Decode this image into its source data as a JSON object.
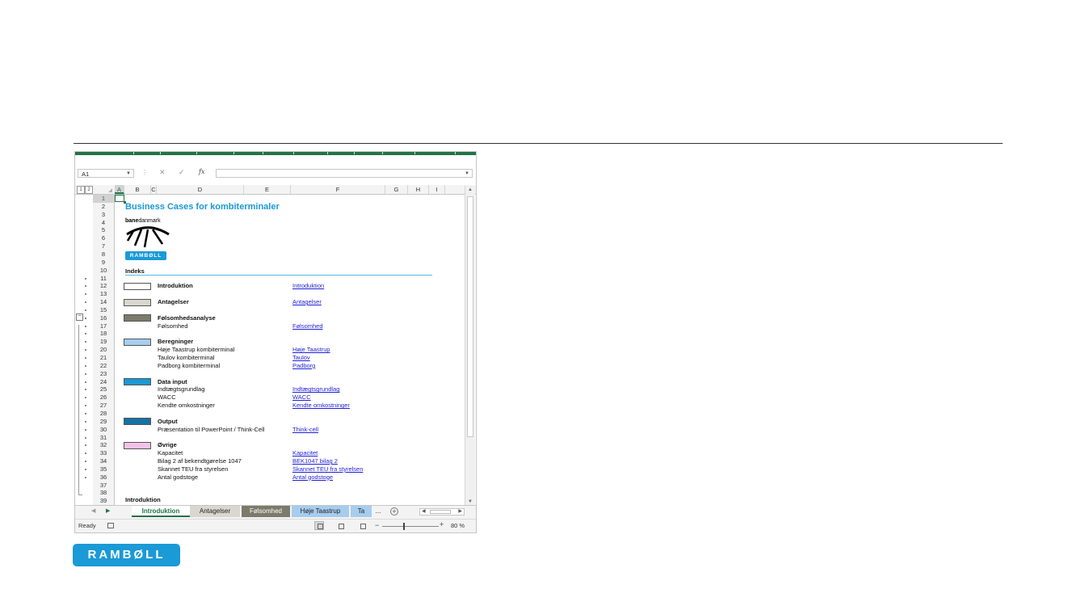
{
  "formula_bar": {
    "name_box": "A1",
    "fx": "fx",
    "formula": ""
  },
  "grid": {
    "level_buttons": [
      "1",
      "2"
    ],
    "columns": [
      "A",
      "B",
      "C",
      "D",
      "E",
      "F",
      "G",
      "H",
      "I"
    ],
    "rows": [
      "1",
      "2",
      "3",
      "4",
      "5",
      "6",
      "7",
      "8",
      "9",
      "10",
      "11",
      "12",
      "13",
      "14",
      "15",
      "16",
      "17",
      "18",
      "19",
      "20",
      "21",
      "22",
      "23",
      "24",
      "25",
      "26",
      "27",
      "28",
      "29",
      "30",
      "31",
      "32",
      "33",
      "34",
      "35",
      "36",
      "37",
      "38",
      "39"
    ],
    "outline_collapse": "−"
  },
  "sheet": {
    "title": "Business Cases for kombiterminaler",
    "banedanmark_bold": "bane",
    "banedanmark_rest": "danmark",
    "ramboll_small": "RAMBØLL",
    "index_heading": "Indeks",
    "sections": [
      {
        "heading": "Introduktion",
        "color": "#ffffff",
        "items": [],
        "link": "Introduktion"
      },
      {
        "heading": "Antagelser",
        "color": "#d8d8d0",
        "items": [],
        "link": "Antagelser"
      },
      {
        "heading": "Følsomhedsanalyse",
        "color": "#7b7b6b",
        "items": [
          {
            "label": "Følsomhed",
            "link": "Følsomhed"
          }
        ]
      },
      {
        "heading": "Beregninger",
        "color": "#a6cdee",
        "items": [
          {
            "label": "Høje Taastrup kombiterminal",
            "link": "Høje Taastrup"
          },
          {
            "label": "Taulov kombiterminal",
            "link": "Taulov"
          },
          {
            "label": "Padborg kombiterminal",
            "link": "Padborg"
          }
        ]
      },
      {
        "heading": "Data input",
        "color": "#1a98d5",
        "items": [
          {
            "label": "Indtægtsgrundlag",
            "link": "Indtægtsgrundlag"
          },
          {
            "label": "WACC",
            "link": "WACC"
          },
          {
            "label": "Kendte omkostninger",
            "link": "Kendte omkostninger"
          }
        ]
      },
      {
        "heading": "Output",
        "color": "#1473a4",
        "items": [
          {
            "label": "Præsentation til PowerPoint / Think-Cell",
            "link": "Think-cell"
          }
        ]
      },
      {
        "heading": "Øvrige",
        "color": "#f4c2e8",
        "items": [
          {
            "label": "Kapacitet",
            "link": "Kapacitet"
          },
          {
            "label": "Bilag 2 af bekendtgørelse 1047",
            "link": "BEK1047 bilag 2"
          },
          {
            "label": "Skannet TEU fra styrelsen",
            "link": "Skannet TEU fra styrelsen"
          },
          {
            "label": "Antal godstoge",
            "link": "Antal godstoge"
          }
        ]
      }
    ],
    "bottom_heading": "Introduktion"
  },
  "tabs": {
    "items": [
      {
        "label": "Introduktion",
        "color": "#ffffff"
      },
      {
        "label": "Antagelser",
        "color": "#d8d8d0"
      },
      {
        "label": "Følsomhed",
        "color": "#7b7b6b"
      },
      {
        "label": "Høje Taastrup",
        "color": "#a6cdee"
      },
      {
        "label": "Ta",
        "color": "#a6cdee"
      }
    ],
    "ellipsis": "...",
    "add": "+"
  },
  "status": {
    "ready": "Ready",
    "zoom_minus": "−",
    "zoom_plus": "+",
    "zoom": "80 %",
    "zoom_level_percent": 80
  },
  "footer": {
    "ramboll_logo": "RAMBØLL"
  },
  "colors": {
    "excel_green": "#217346",
    "ramboll_blue": "#1a9ad6",
    "title_blue": "#1a98d5",
    "link_blue": "#1f1fd6"
  }
}
